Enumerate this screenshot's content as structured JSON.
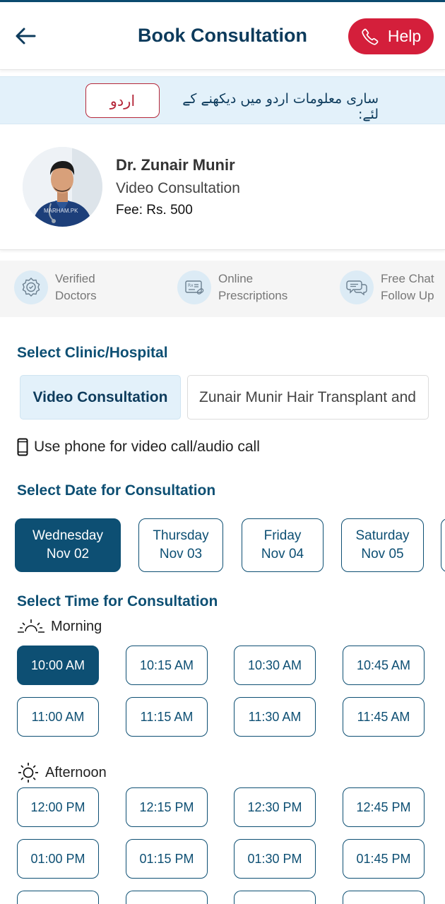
{
  "header": {
    "title": "Book Consultation",
    "help_label": "Help"
  },
  "urdu_banner": {
    "text": "ساری معلومات اردو میں دیکھنے کے لئے:",
    "button_label": "اردو"
  },
  "doctor": {
    "name": "Dr. Zunair Munir",
    "consultation_type": "Video Consultation",
    "fee": "Fee: Rs. 500",
    "avatar_watermark": "MARHAM.PK"
  },
  "features": [
    {
      "line1": "Verified",
      "line2": "Doctors",
      "icon": "badge-icon"
    },
    {
      "line1": "Online",
      "line2": "Prescriptions",
      "icon": "prescription-icon"
    },
    {
      "line1": "Free Chat",
      "line2": "Follow Up",
      "icon": "chat-icon"
    }
  ],
  "clinic_section": {
    "title": "Select Clinic/Hospital",
    "tabs": [
      "Video Consultation",
      "Zunair Munir Hair Transplant and"
    ],
    "selected_index": 0,
    "phone_note": "Use phone for video call/audio call"
  },
  "date_section": {
    "title": "Select Date for Consultation",
    "dates": [
      {
        "day": "Wednesday",
        "date": "Nov 02"
      },
      {
        "day": "Thursday",
        "date": "Nov 03"
      },
      {
        "day": "Friday",
        "date": "Nov 04"
      },
      {
        "day": "Saturday",
        "date": "Nov 05"
      }
    ],
    "selected_index": 0
  },
  "time_section": {
    "title": "Select Time for Consultation",
    "morning_label": "Morning",
    "afternoon_label": "Afternoon",
    "morning_slots": [
      "10:00 AM",
      "10:15 AM",
      "10:30 AM",
      "10:45 AM",
      "11:00 AM",
      "11:15 AM",
      "11:30 AM",
      "11:45 AM"
    ],
    "afternoon_slots": [
      "12:00 PM",
      "12:15 PM",
      "12:30 PM",
      "12:45 PM",
      "01:00 PM",
      "01:15 PM",
      "01:30 PM",
      "01:45 PM"
    ],
    "selected_slot": "10:00 AM"
  },
  "colors": {
    "primary": "#0d4f73",
    "help_red": "#d41f3b",
    "banner_bg": "#e3f1fa"
  }
}
